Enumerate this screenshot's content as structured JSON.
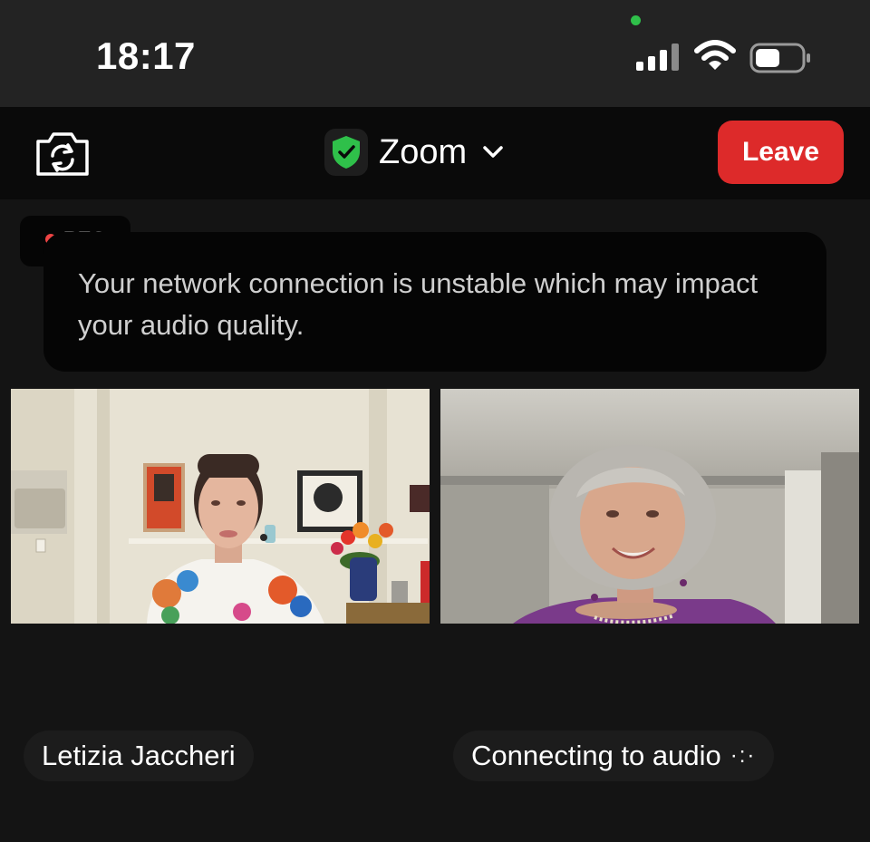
{
  "status_bar": {
    "time": "18:17",
    "icons": [
      "camera-in-use-indicator",
      "cellular-signal-icon",
      "wifi-icon",
      "battery-icon"
    ]
  },
  "top_bar": {
    "title": "Zoom",
    "leave_label": "Leave",
    "icons": [
      "camera-switch-icon",
      "security-shield-icon",
      "chevron-down-icon"
    ]
  },
  "recording": {
    "label": "REC"
  },
  "toast": {
    "message": "Your network connection is unstable which may impact your audio quality."
  },
  "participants": [
    {
      "name": "Letizia Jaccheri"
    },
    {
      "name": "Connecting to audio",
      "status_icon": "dots-icon"
    }
  ],
  "colors": {
    "leave": "#dd2a2a",
    "shield": "#2fc04a",
    "camera_indicator": "#2fc04a",
    "background": "#141414"
  }
}
